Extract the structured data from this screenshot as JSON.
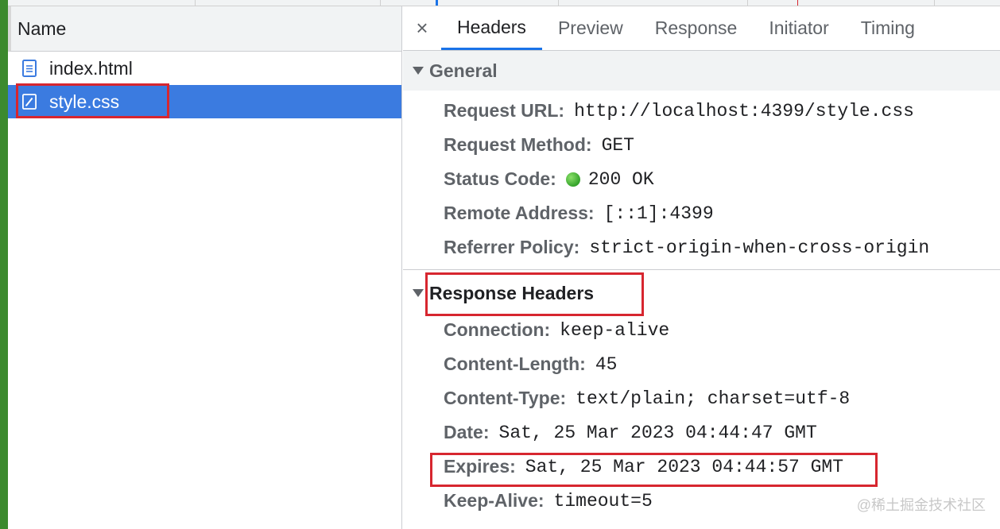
{
  "left": {
    "column_header": "Name",
    "files": [
      {
        "name": "index.html",
        "icon": "document-icon",
        "selected": false
      },
      {
        "name": "style.css",
        "icon": "stylesheet-icon",
        "selected": true
      }
    ]
  },
  "tabs": {
    "close": "×",
    "items": [
      "Headers",
      "Preview",
      "Response",
      "Initiator",
      "Timing"
    ],
    "active": "Headers"
  },
  "general": {
    "title": "General",
    "rows": [
      {
        "key": "Request URL:",
        "value": "http://localhost:4399/style.css"
      },
      {
        "key": "Request Method:",
        "value": "GET"
      },
      {
        "key": "Status Code:",
        "value": "200 OK"
      },
      {
        "key": "Remote Address:",
        "value": "[::1]:4399"
      },
      {
        "key": "Referrer Policy:",
        "value": "strict-origin-when-cross-origin"
      }
    ]
  },
  "response_headers": {
    "title": "Response Headers",
    "rows": [
      {
        "key": "Connection:",
        "value": "keep-alive"
      },
      {
        "key": "Content-Length:",
        "value": "45"
      },
      {
        "key": "Content-Type:",
        "value": "text/plain; charset=utf-8"
      },
      {
        "key": "Date:",
        "value": "Sat, 25 Mar 2023 04:44:47 GMT"
      },
      {
        "key": "Expires:",
        "value": "Sat, 25 Mar 2023 04:44:57 GMT"
      },
      {
        "key": "Keep-Alive:",
        "value": "timeout=5"
      }
    ]
  },
  "watermark": "@稀土掘金技术社区",
  "colors": {
    "selected_row": "#3b7be0",
    "highlight": "#d7262f",
    "status_ok": "#34a32a",
    "active_tab": "#1a73e8"
  }
}
